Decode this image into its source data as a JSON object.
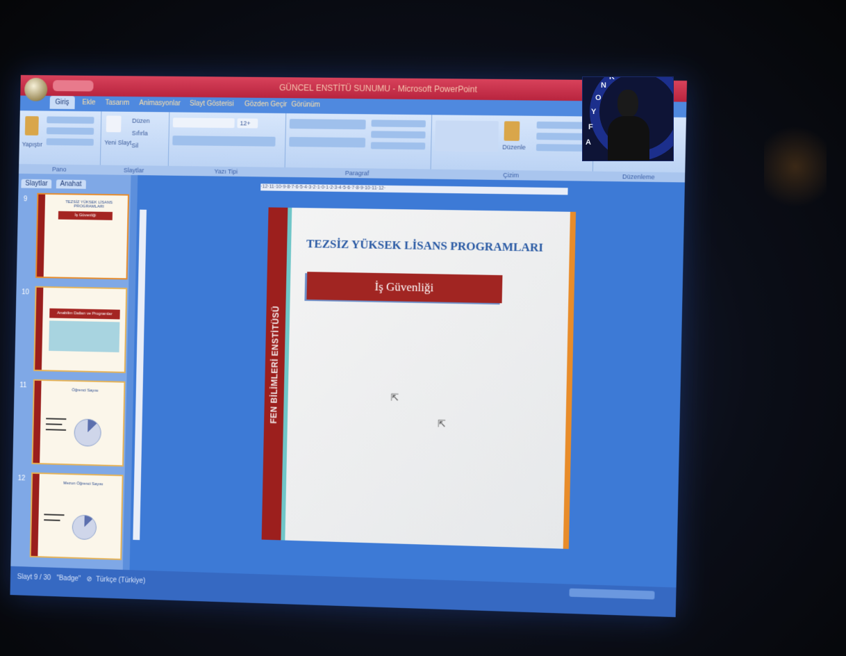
{
  "window": {
    "title": "GÜNCEL ENSTİTÜ SUNUMU - Microsoft PowerPoint"
  },
  "ribbon": {
    "tabs": [
      "Giriş",
      "Ekle",
      "Tasarım",
      "Animasyonlar",
      "Slayt Gösterisi",
      "Gözden Geçir",
      "Görünüm"
    ],
    "groups": [
      "Pano",
      "Slaytlar",
      "Yazı Tipi",
      "Paragraf",
      "Çizim",
      "Düzenleme"
    ],
    "labels": {
      "paste": "Yapıştır",
      "new_slide": "Yeni Slayt",
      "layout": "Düzen",
      "reset": "Sıfırla",
      "delete": "Sil",
      "arrange": "Düzenle",
      "font_size": "12+"
    }
  },
  "panel": {
    "tabs": [
      "Slaytlar",
      "Anahat"
    ]
  },
  "thumbnails": [
    {
      "num": "9",
      "title": "TEZSİZ YÜKSEK LİSANS PROGRAMLARI",
      "box": "İş Güvenliği"
    },
    {
      "num": "10",
      "title": "Anabilim Dalları ve Programlar"
    },
    {
      "num": "11",
      "title": "Öğrenci Sayısı"
    },
    {
      "num": "12",
      "title": "Mezun Öğrenci Sayısı"
    }
  ],
  "slide": {
    "title": "TEZSİZ YÜKSEK LİSANS PROGRAMLARI",
    "subtitle": "İş Güvenliği",
    "side_text": "FEN BİLİMLERİ ENSTİTÜSÜ"
  },
  "ruler": {
    "h": "·12·11·10·9·8·7·6·5·4·3·2·1·0·1·2·3·4·5·6·7·8·9·10·11·12·"
  },
  "status": {
    "slide": "Slayt 9 / 30",
    "theme": "\"Badge\"",
    "language": "Türkçe (Türkiye)"
  },
  "webcam": {
    "letters": [
      "A",
      "F",
      "Y",
      "O",
      "N",
      "K"
    ]
  },
  "colors": {
    "accent_red": "#9c1f1d",
    "title_blue": "#2a5aa4",
    "orange": "#e88c2a"
  }
}
